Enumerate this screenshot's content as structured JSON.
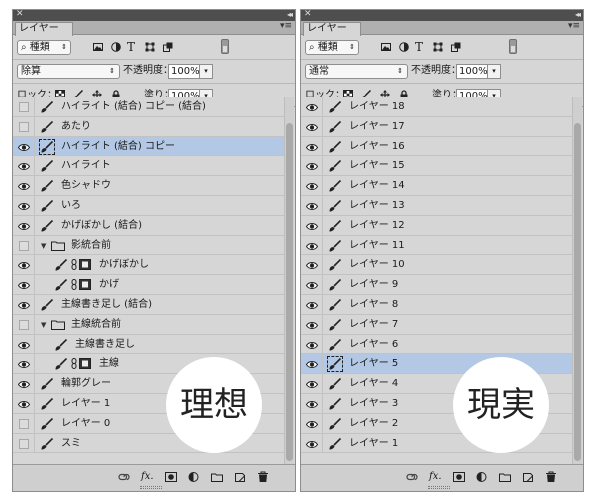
{
  "left_panel": {
    "tab_label": "レイヤー",
    "filter_kind": "種類",
    "blend_mode": "除算",
    "opacity_label": "不透明度：",
    "opacity_value": "100%",
    "lock_label": "ロック：",
    "fill_label": "塗り：",
    "fill_value": "100%",
    "layers": [
      {
        "name": "ハイライト (結合) コピー (結合)",
        "visible": false,
        "indent": 0,
        "type": "paint",
        "selected": false
      },
      {
        "name": "あたり",
        "visible": false,
        "indent": 0,
        "type": "paint",
        "selected": false
      },
      {
        "name": "ハイライト (結合) コピー",
        "visible": true,
        "indent": 0,
        "type": "paint",
        "selected": true
      },
      {
        "name": "ハイライト",
        "visible": true,
        "indent": 0,
        "type": "paint",
        "selected": false
      },
      {
        "name": "色シャドウ",
        "visible": true,
        "indent": 0,
        "type": "paint",
        "selected": false
      },
      {
        "name": "いろ",
        "visible": true,
        "indent": 0,
        "type": "paint",
        "selected": false
      },
      {
        "name": "かげぼかし (結合)",
        "visible": true,
        "indent": 0,
        "type": "paint",
        "selected": false
      },
      {
        "name": "影統合前",
        "visible": false,
        "indent": 0,
        "type": "folder",
        "selected": false
      },
      {
        "name": "かげぼかし",
        "visible": true,
        "indent": 1,
        "type": "masked",
        "selected": false
      },
      {
        "name": "かげ",
        "visible": true,
        "indent": 1,
        "type": "masked",
        "selected": false
      },
      {
        "name": "主線書き足し (結合)",
        "visible": true,
        "indent": 0,
        "type": "paint",
        "selected": false
      },
      {
        "name": "主線統合前",
        "visible": false,
        "indent": 0,
        "type": "folder",
        "selected": false
      },
      {
        "name": "主線書き足し",
        "visible": true,
        "indent": 1,
        "type": "paint",
        "selected": false
      },
      {
        "name": "主線",
        "visible": true,
        "indent": 1,
        "type": "masked",
        "selected": false
      },
      {
        "name": "輪郭グレー",
        "visible": true,
        "indent": 0,
        "type": "paint",
        "selected": false
      },
      {
        "name": "レイヤー 1",
        "visible": true,
        "indent": 0,
        "type": "paint",
        "selected": false
      },
      {
        "name": "レイヤー 0",
        "visible": false,
        "indent": 0,
        "type": "paint",
        "selected": false
      },
      {
        "name": "スミ",
        "visible": false,
        "indent": 0,
        "type": "paint",
        "selected": false
      }
    ],
    "badge": "理想"
  },
  "right_panel": {
    "tab_label": "レイヤー",
    "filter_kind": "種類",
    "blend_mode": "通常",
    "opacity_label": "不透明度：",
    "opacity_value": "100%",
    "lock_label": "ロック：",
    "fill_label": "塗り：",
    "fill_value": "100%",
    "layers": [
      {
        "name": "レイヤー 18",
        "visible": true,
        "selected": false
      },
      {
        "name": "レイヤー 17",
        "visible": true,
        "selected": false
      },
      {
        "name": "レイヤー 16",
        "visible": true,
        "selected": false
      },
      {
        "name": "レイヤー 15",
        "visible": true,
        "selected": false
      },
      {
        "name": "レイヤー 14",
        "visible": true,
        "selected": false
      },
      {
        "name": "レイヤー 13",
        "visible": true,
        "selected": false
      },
      {
        "name": "レイヤー 12",
        "visible": true,
        "selected": false
      },
      {
        "name": "レイヤー 11",
        "visible": true,
        "selected": false
      },
      {
        "name": "レイヤー 10",
        "visible": true,
        "selected": false
      },
      {
        "name": "レイヤー 9",
        "visible": true,
        "selected": false
      },
      {
        "name": "レイヤー 8",
        "visible": true,
        "selected": false
      },
      {
        "name": "レイヤー 7",
        "visible": true,
        "selected": false
      },
      {
        "name": "レイヤー 6",
        "visible": true,
        "selected": false
      },
      {
        "name": "レイヤー 5",
        "visible": true,
        "selected": true
      },
      {
        "name": "レイヤー 4",
        "visible": true,
        "selected": false
      },
      {
        "name": "レイヤー 3",
        "visible": true,
        "selected": false
      },
      {
        "name": "レイヤー 2",
        "visible": true,
        "selected": false
      },
      {
        "name": "レイヤー 1",
        "visible": true,
        "selected": false
      }
    ],
    "badge": "現実"
  },
  "icons": {
    "close": "close-icon",
    "collapse": "double-chevron-icon",
    "panel_menu": "panel-menu-icon",
    "search": "search-icon",
    "filter_pixel": "image-filter-icon",
    "filter_adjust": "adjustment-filter-icon",
    "filter_type": "type-filter-icon",
    "filter_shape": "shape-filter-icon",
    "filter_smart": "smart-object-filter-icon",
    "eye": "eye-icon",
    "brush": "brush-icon",
    "folder": "folder-icon",
    "chain": "link-chain-icon",
    "mask_thumb": "mask-thumbnail-icon",
    "lock_pixels": "lock-transparent-pixels-icon",
    "lock_paint": "lock-image-pixels-icon",
    "lock_move": "lock-position-icon",
    "lock_all": "lock-all-icon",
    "footer_link": "link-layers-icon",
    "footer_fx": "fx-icon",
    "footer_mask": "add-mask-icon",
    "footer_adjust": "new-adjustment-layer-icon",
    "footer_group": "new-group-icon",
    "footer_new": "new-layer-icon",
    "footer_delete": "trash-icon"
  },
  "colors": {
    "panel_bg": "#d6d6d6",
    "selected_row": "#b2c8e4",
    "titlebar": "#4e4e4e"
  }
}
